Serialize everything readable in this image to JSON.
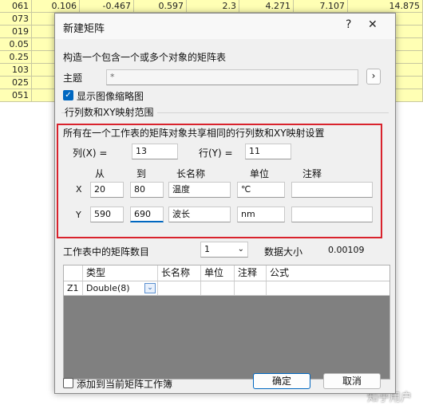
{
  "background_sheet": {
    "rows": [
      [
        "061",
        "0.106",
        "-0.467",
        "0.597",
        "2.3",
        "4.271",
        "7.107",
        "14.875"
      ],
      [
        "073",
        "",
        "",
        "",
        "",
        "",
        "",
        ""
      ],
      [
        "019",
        "-0",
        "",
        "",
        "",
        "",
        "",
        ""
      ],
      [
        "0.05",
        "-0",
        "",
        "",
        "",
        "",
        "",
        ""
      ],
      [
        "0.25",
        "0",
        "",
        "",
        "",
        "",
        "",
        ""
      ],
      [
        "103",
        "0",
        "",
        "",
        "",
        "",
        "",
        ""
      ],
      [
        "025",
        "0",
        "",
        "",
        "",
        "",
        "",
        ""
      ],
      [
        "051",
        "0",
        "",
        "",
        "",
        "",
        "",
        ""
      ]
    ]
  },
  "watermark": "知乎用户",
  "dialog": {
    "title": "新建矩阵",
    "help_icon": "?",
    "close_icon": "✕",
    "description": "构造一个包含一个或多个对象的矩阵表",
    "subject_label": "主题",
    "subject_value": "*",
    "subject_button": "›",
    "show_thumbnail_label": "显示图像缩略图",
    "show_thumbnail_checked": true,
    "group_title": "行列数和XY映射范围",
    "shared_note": "所有在一个工作表的矩阵对象共享相同的行列数和XY映射设置",
    "cols_label": "列(X) =",
    "cols_value": "13",
    "rows_label": "行(Y) =",
    "rows_value": "11",
    "mapping_headers": {
      "from": "从",
      "to": "到",
      "longname": "长名称",
      "unit": "单位",
      "comment": "注释"
    },
    "x_row": {
      "axis": "X",
      "from": "20",
      "to": "80",
      "longname": "温度",
      "unit": "℃",
      "comment": ""
    },
    "y_row": {
      "axis": "Y",
      "from": "590",
      "to": "690",
      "longname": "波长",
      "unit": "nm",
      "comment": ""
    },
    "matrix_count_label": "工作表中的矩阵数目",
    "matrix_count_value": "1",
    "data_size_label": "数据大小",
    "data_size_value": "0.00109",
    "grid": {
      "headers": [
        "类型",
        "长名称",
        "单位",
        "注释",
        "公式"
      ],
      "rows": [
        {
          "name": "Z1",
          "type": "Double(8)",
          "longname": "",
          "unit": "",
          "comment": "",
          "formula": ""
        }
      ]
    },
    "add_to_current_label": "添加到当前矩阵工作簿",
    "add_to_current_checked": false,
    "ok_label": "确定",
    "cancel_label": "取消"
  }
}
